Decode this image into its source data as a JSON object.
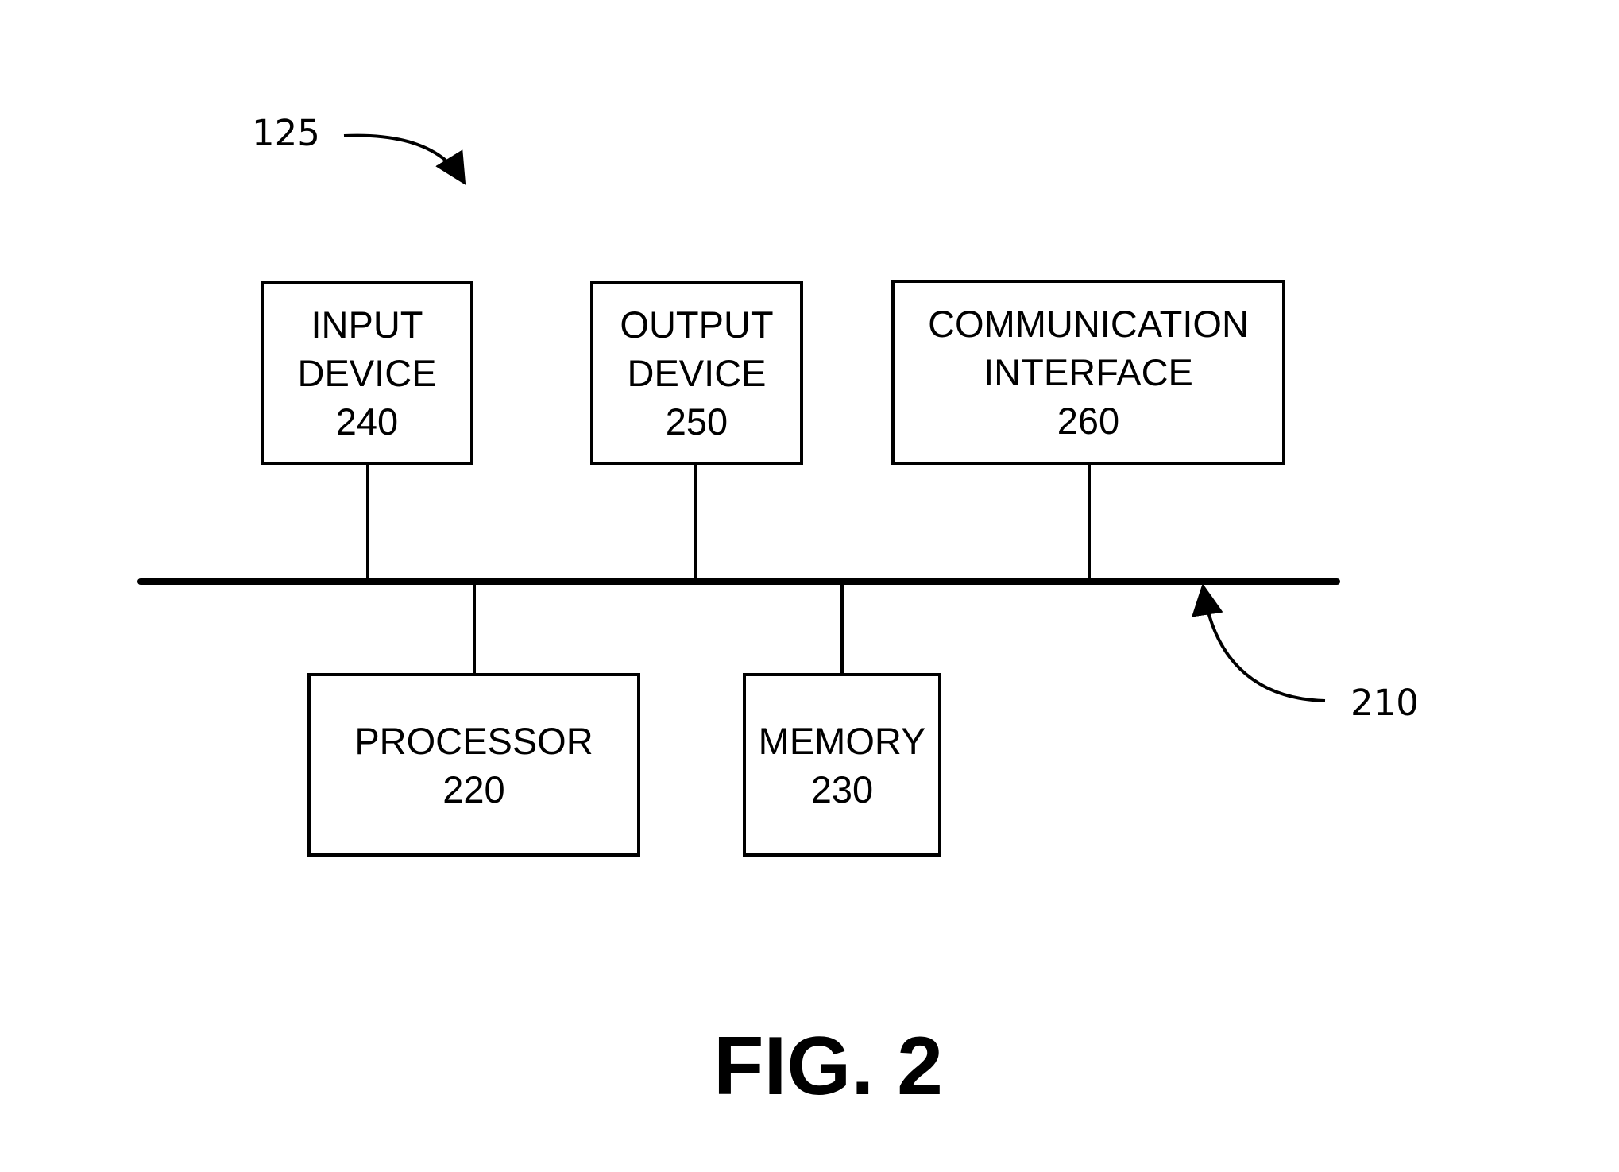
{
  "figure": {
    "title": "FIG. 2",
    "system_ref": "125",
    "bus_ref": "210"
  },
  "components": {
    "input": {
      "lines": [
        "INPUT",
        "DEVICE",
        "240"
      ]
    },
    "output": {
      "lines": [
        "OUTPUT",
        "DEVICE",
        "250"
      ]
    },
    "comm": {
      "lines": [
        "COMMUNICATION",
        "INTERFACE",
        "260"
      ]
    },
    "processor": {
      "lines": [
        "PROCESSOR",
        "220"
      ]
    },
    "memory": {
      "lines": [
        "MEMORY",
        "230"
      ]
    }
  }
}
